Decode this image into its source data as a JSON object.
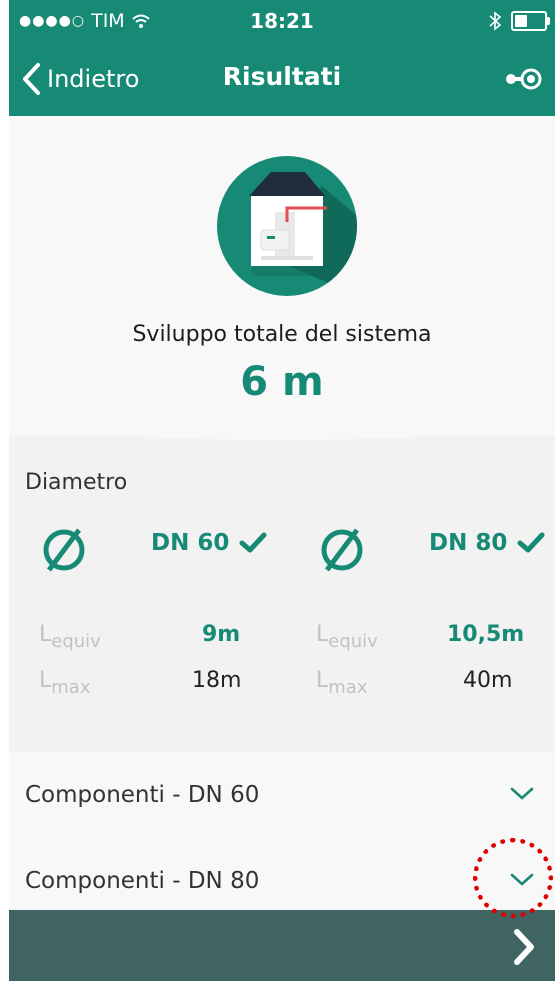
{
  "status": {
    "carrier": "TIM",
    "time": "18:21"
  },
  "nav": {
    "back_label": "Indietro",
    "title": "Risultati"
  },
  "hero": {
    "subtitle": "Sviluppo totale del sistema",
    "value": "6 m"
  },
  "diameter": {
    "title": "Diametro",
    "options": [
      {
        "label": "DN 60",
        "l_equiv": "9m",
        "l_max": "18m"
      },
      {
        "label": "DN 80",
        "l_equiv": "10,5m",
        "l_max": "40m"
      }
    ],
    "l_prefix": "L",
    "equiv_sub": "equiv",
    "max_sub": "max"
  },
  "accordions": [
    {
      "label": "Componenti - DN 60"
    },
    {
      "label": "Componenti - DN 80"
    }
  ],
  "colors": {
    "primary": "#178a75",
    "footer": "#406461",
    "accent_red": "#e00000"
  }
}
